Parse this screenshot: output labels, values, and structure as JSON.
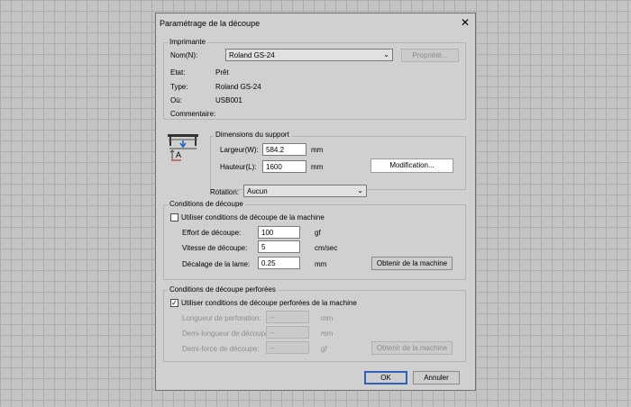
{
  "dialog": {
    "title": "Paramétrage de la découpe",
    "close_glyph": "✕"
  },
  "printer": {
    "legend": "Imprimante",
    "name_label": "Nom(N):",
    "name_value": "Roland GS-24",
    "properties_button": "Propriété...",
    "state_label": "Etat:",
    "state_value": "Prêt",
    "type_label": "Type:",
    "type_value": "Roland GS-24",
    "where_label": "Où:",
    "where_value": "USB001",
    "comment_label": "Commentaire:"
  },
  "media": {
    "legend": "Dimensions du support",
    "width_label": "Largeur(W):",
    "width_value": "584.2",
    "width_unit": "mm",
    "height_label": "Hauteur(L):",
    "height_value": "1600",
    "height_unit": "mm",
    "modify_button": "Modification...",
    "icon_letter": "A"
  },
  "rotation": {
    "label": "Rotation:",
    "value": "Aucun"
  },
  "cutting": {
    "legend": "Conditions de découpe",
    "use_machine_label": "Utiliser conditions de découpe de la machine",
    "use_machine_checked": false,
    "force_label": "Effort de découpe:",
    "force_value": "100",
    "force_unit": "gf",
    "speed_label": "Vitesse de découpe:",
    "speed_value": "5",
    "speed_unit": "cm/sec",
    "offset_label": "Décalage de la lame:",
    "offset_value": "0.25",
    "offset_unit": "mm",
    "get_button": "Obtenir de la machine"
  },
  "perforated": {
    "legend": "Conditions de découpe perforées",
    "use_machine_label": "Utiliser conditions de découpe perforées de la machine",
    "use_machine_checked": true,
    "check_glyph": "✓",
    "length_label": "Longueur de perforation:",
    "length_value": "--",
    "length_unit": "mm",
    "half_length_label": "Demi-longueur de découpe:",
    "half_length_value": "--",
    "half_length_unit": "mm",
    "half_force_label": "Demi-force de découpe:",
    "half_force_value": "--",
    "half_force_unit": "gf",
    "get_button": "Obtenir de la machine"
  },
  "footer": {
    "ok": "OK",
    "cancel": "Annuler"
  },
  "icons": {
    "dropdown": "⌄"
  }
}
